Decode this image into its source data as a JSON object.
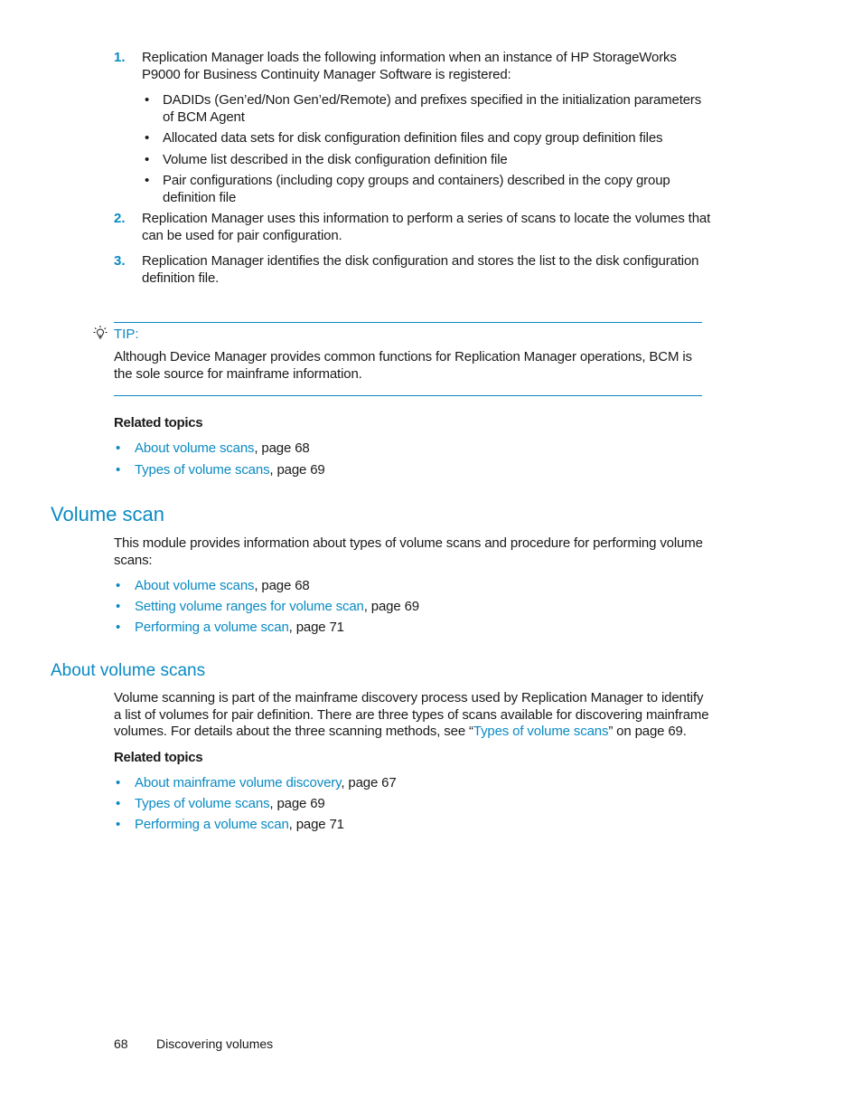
{
  "steps": [
    {
      "number": "1.",
      "lines": [
        "Replication Manager loads the following information when an instance of HP StorageWorks",
        "P9000 for Business Continuity Manager Software is registered:"
      ],
      "bullets": [
        {
          "lines": [
            "DADIDs (Gen’ed/Non Gen’ed/Remote) and prefixes specified in the initialization parameters",
            "of BCM Agent"
          ]
        },
        {
          "lines": [
            "Allocated data sets for disk configuration definition files and copy group definition files"
          ]
        },
        {
          "lines": [
            "Volume list described in the disk configuration definition file"
          ]
        },
        {
          "lines": [
            "Pair configurations (including copy groups and containers) described in the copy group",
            "definition file"
          ]
        }
      ]
    },
    {
      "number": "2.",
      "lines": [
        "Replication Manager uses this information to perform a series of scans to locate the volumes that",
        "can be used for pair configuration."
      ]
    },
    {
      "number": "3.",
      "lines": [
        "Replication Manager identifies the disk configuration and stores the list to the disk configuration",
        "definition file."
      ]
    }
  ],
  "tip": {
    "icon": "lightbulb-icon",
    "label": "TIP:",
    "lines": [
      "Although Device Manager provides common functions for Replication Manager operations, BCM is",
      "the sole source for mainframe information."
    ]
  },
  "related_topics_1": {
    "heading": "Related topics",
    "items": [
      {
        "link": "About volume scans",
        "suffix": ", page 68"
      },
      {
        "link": "Types of volume scans",
        "suffix": ", page 69"
      }
    ]
  },
  "volume_scan": {
    "heading": "Volume scan",
    "lines": [
      "This module provides information about types of volume scans and procedure for performing volume",
      "scans:"
    ],
    "items": [
      {
        "link": "About volume scans",
        "suffix": ", page 68"
      },
      {
        "link": "Setting volume ranges for volume scan",
        "suffix": ", page 69"
      },
      {
        "link": "Performing a volume scan",
        "suffix": ", page 71"
      }
    ]
  },
  "about_volume_scans": {
    "heading": "About volume scans",
    "line1": "Volume scanning is part of the mainframe discovery process used by Replication Manager to identify",
    "line2": "a list of volumes for pair definition. There are three types of scans available for discovering mainframe",
    "line3_prefix": "volumes. For details about the three scanning methods, see “",
    "line3_link": "Types of volume scans",
    "line3_suffix": "” on page 69.",
    "related_heading": "Related topics",
    "items": [
      {
        "link": "About mainframe volume discovery",
        "suffix": ", page 67"
      },
      {
        "link": "Types of volume scans",
        "suffix": ", page 69"
      },
      {
        "link": "Performing a volume scan",
        "suffix": ", page 71"
      }
    ]
  },
  "footer": {
    "page_number": "68",
    "chapter": "Discovering volumes"
  },
  "colors": {
    "accent": "#0a8ac2",
    "text": "#1a1a1a"
  }
}
